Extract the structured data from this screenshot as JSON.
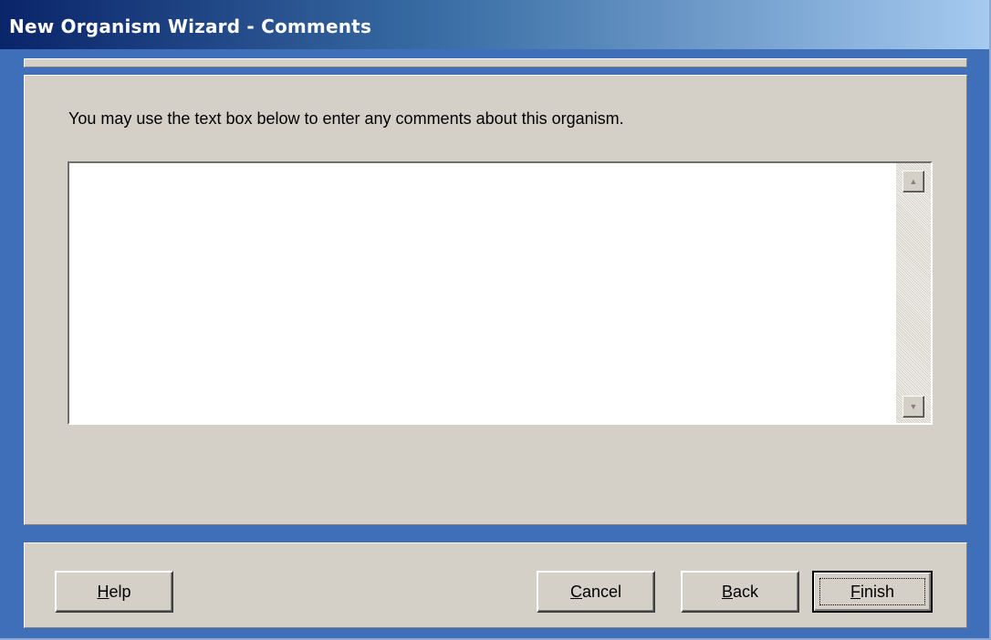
{
  "window": {
    "title": "New Organism Wizard - Comments"
  },
  "main": {
    "instruction": "You may use the text box below to enter any comments about this organism.",
    "comments_value": "",
    "scroll_up_glyph": "▲",
    "scroll_down_glyph": "▼"
  },
  "footer": {
    "help": {
      "mnemonic": "H",
      "rest": "elp"
    },
    "cancel": {
      "mnemonic": "C",
      "rest": "ancel"
    },
    "back": {
      "mnemonic": "B",
      "rest": "ack"
    },
    "finish": {
      "mnemonic": "F",
      "rest": "inish"
    }
  },
  "colors": {
    "frame_blue": "#3e6fb8",
    "panel_gray": "#d4d0c8",
    "title_gradient_start": "#0a246a",
    "title_gradient_end": "#a6caf0"
  },
  "icons": {
    "scroll_up": "arrow-up-icon",
    "scroll_down": "arrow-down-icon"
  }
}
